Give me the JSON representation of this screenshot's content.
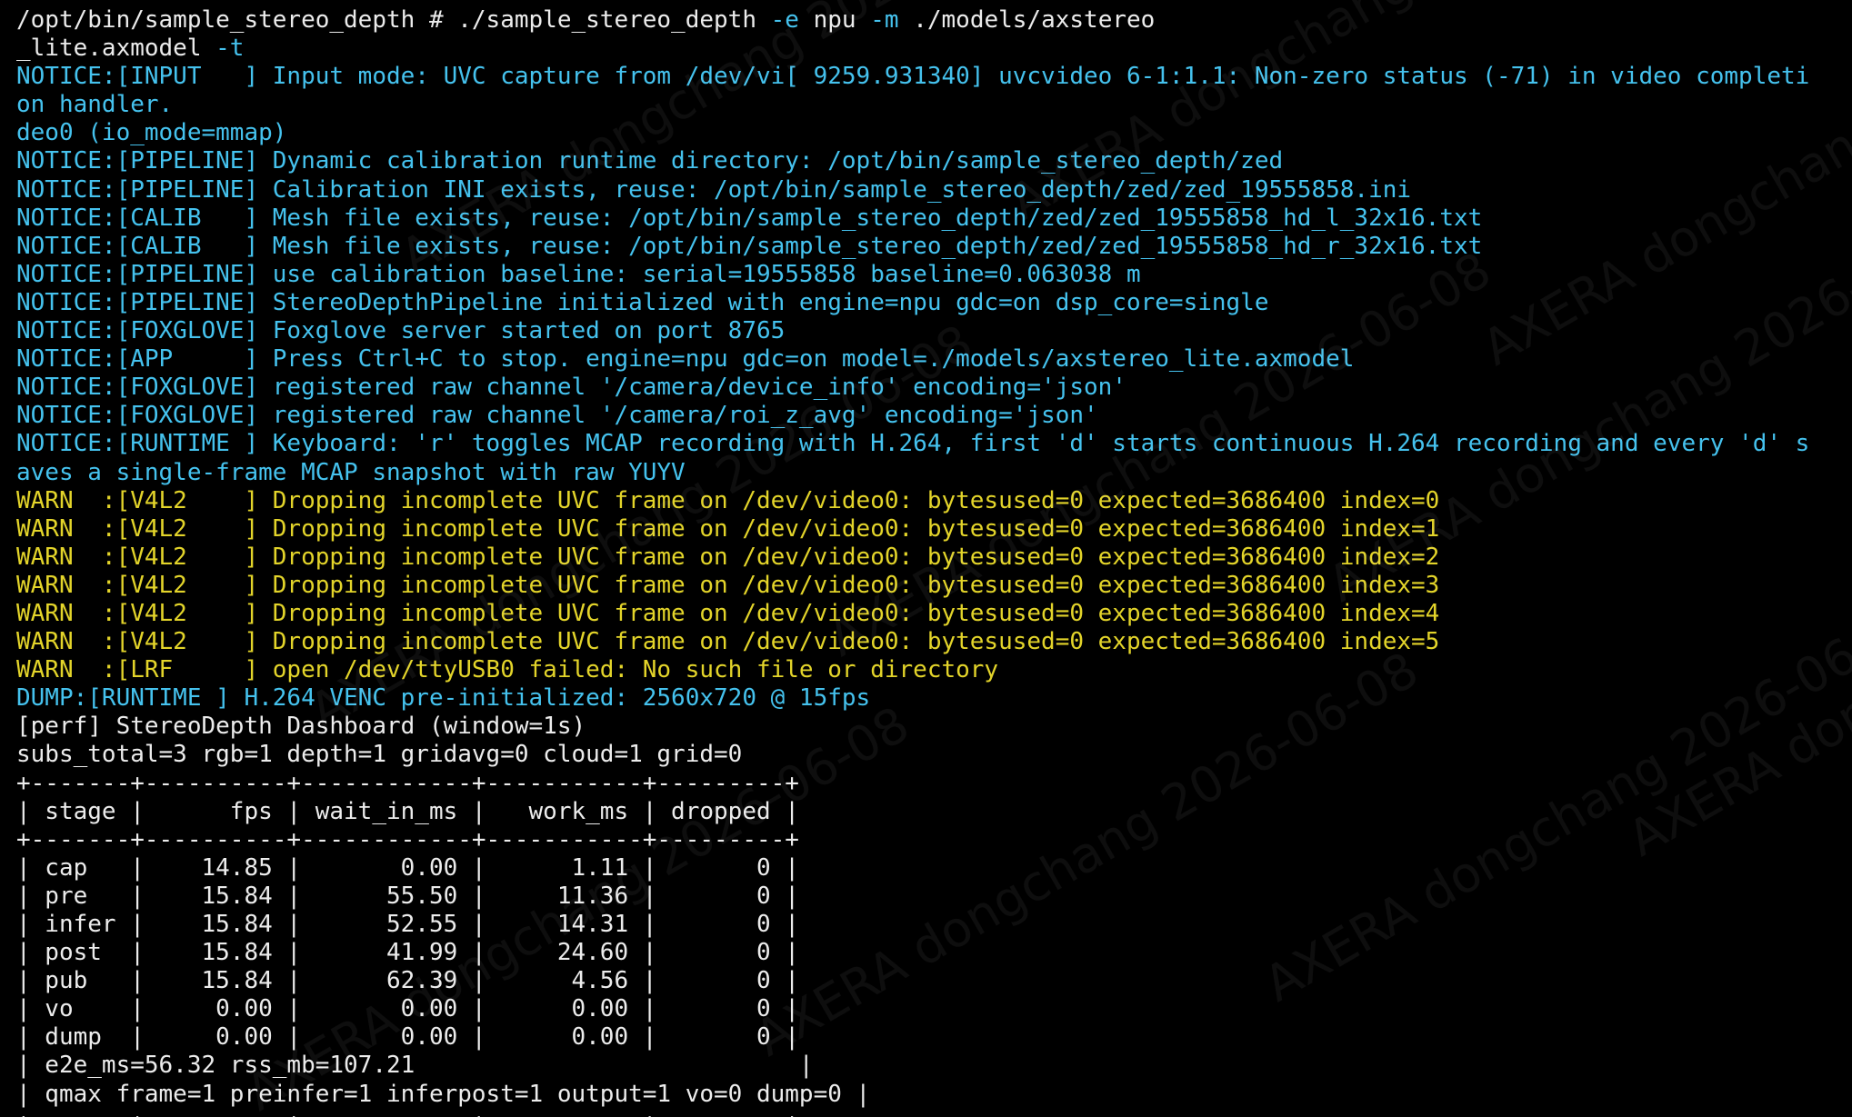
{
  "terminal": {
    "lines": [
      {
        "segments": [
          {
            "text": "/opt/bin/sample_stereo_depth # ./sample_stereo_depth ",
            "color": "w"
          },
          {
            "text": "-e",
            "color": "opt"
          },
          {
            "text": " npu ",
            "color": "w"
          },
          {
            "text": "-m",
            "color": "opt"
          },
          {
            "text": " ./models/axstereo",
            "color": "w"
          }
        ]
      },
      {
        "segments": [
          {
            "text": "_lite.axmodel ",
            "color": "w"
          },
          {
            "text": "-t",
            "color": "opt"
          }
        ]
      },
      {
        "segments": [
          {
            "text": "NOTICE:[INPUT   ] Input mode: UVC capture from /dev/vi[ 9259.931340] uvcvideo 6-1:1.1: Non-zero status (-71) in video completi",
            "color": "c"
          }
        ]
      },
      {
        "segments": [
          {
            "text": "on handler.",
            "color": "c"
          }
        ]
      },
      {
        "segments": [
          {
            "text": "deo0 (io_mode=mmap)",
            "color": "c"
          }
        ]
      },
      {
        "segments": [
          {
            "text": "NOTICE:[PIPELINE] Dynamic calibration runtime directory: /opt/bin/sample_stereo_depth/zed",
            "color": "c"
          }
        ]
      },
      {
        "segments": [
          {
            "text": "NOTICE:[PIPELINE] Calibration INI exists, reuse: /opt/bin/sample_stereo_depth/zed/zed_19555858.ini",
            "color": "c"
          }
        ]
      },
      {
        "segments": [
          {
            "text": "NOTICE:[CALIB   ] Mesh file exists, reuse: /opt/bin/sample_stereo_depth/zed/zed_19555858_hd_l_32x16.txt",
            "color": "c"
          }
        ]
      },
      {
        "segments": [
          {
            "text": "NOTICE:[CALIB   ] Mesh file exists, reuse: /opt/bin/sample_stereo_depth/zed/zed_19555858_hd_r_32x16.txt",
            "color": "c"
          }
        ]
      },
      {
        "segments": [
          {
            "text": "NOTICE:[PIPELINE] use calibration baseline: serial=19555858 baseline=0.063038 m",
            "color": "c"
          }
        ]
      },
      {
        "segments": [
          {
            "text": "NOTICE:[PIPELINE] StereoDepthPipeline initialized with engine=npu gdc=on dsp_core=single",
            "color": "c"
          }
        ]
      },
      {
        "segments": [
          {
            "text": "NOTICE:[FOXGLOVE] Foxglove server started on port 8765",
            "color": "c"
          }
        ]
      },
      {
        "segments": [
          {
            "text": "NOTICE:[APP     ] Press Ctrl+C to stop. engine=npu gdc=on model=./models/axstereo_lite.axmodel",
            "color": "c"
          }
        ]
      },
      {
        "segments": [
          {
            "text": "NOTICE:[FOXGLOVE] registered raw channel '/camera/device_info' encoding='json'",
            "color": "c"
          }
        ]
      },
      {
        "segments": [
          {
            "text": "NOTICE:[FOXGLOVE] registered raw channel '/camera/roi_z_avg' encoding='json'",
            "color": "c"
          }
        ]
      },
      {
        "segments": [
          {
            "text": "NOTICE:[RUNTIME ] Keyboard: 'r' toggles MCAP recording with H.264, first 'd' starts continuous H.264 recording and every 'd' s",
            "color": "c"
          }
        ]
      },
      {
        "segments": [
          {
            "text": "aves a single-frame MCAP snapshot with raw YUYV",
            "color": "c"
          }
        ]
      },
      {
        "segments": [
          {
            "text": "WARN  :[V4L2    ] Dropping incomplete UVC frame on /dev/video0: bytesused=0 expected=3686400 index=0",
            "color": "y"
          }
        ]
      },
      {
        "segments": [
          {
            "text": "WARN  :[V4L2    ] Dropping incomplete UVC frame on /dev/video0: bytesused=0 expected=3686400 index=1",
            "color": "y"
          }
        ]
      },
      {
        "segments": [
          {
            "text": "WARN  :[V4L2    ] Dropping incomplete UVC frame on /dev/video0: bytesused=0 expected=3686400 index=2",
            "color": "y"
          }
        ]
      },
      {
        "segments": [
          {
            "text": "WARN  :[V4L2    ] Dropping incomplete UVC frame on /dev/video0: bytesused=0 expected=3686400 index=3",
            "color": "y"
          }
        ]
      },
      {
        "segments": [
          {
            "text": "WARN  :[V4L2    ] Dropping incomplete UVC frame on /dev/video0: bytesused=0 expected=3686400 index=4",
            "color": "y"
          }
        ]
      },
      {
        "segments": [
          {
            "text": "WARN  :[V4L2    ] Dropping incomplete UVC frame on /dev/video0: bytesused=0 expected=3686400 index=5",
            "color": "y"
          }
        ]
      },
      {
        "segments": [
          {
            "text": "WARN  :[LRF     ] open /dev/ttyUSB0 failed: No such file or directory",
            "color": "y"
          }
        ]
      },
      {
        "segments": [
          {
            "text": "DUMP:[RUNTIME ] H.264 VENC pre-initialized: 2560x720 @ 15fps",
            "color": "c"
          }
        ]
      },
      {
        "segments": [
          {
            "text": "[perf] StereoDepth Dashboard (window=1s)",
            "color": "w"
          }
        ]
      },
      {
        "segments": [
          {
            "text": "subs_total=3 rgb=1 depth=1 gridavg=0 cloud=1 grid=0",
            "color": "w"
          }
        ]
      },
      {
        "segments": [
          {
            "text": "+-------+----------+------------+-----------+---------+",
            "color": "w"
          }
        ]
      },
      {
        "segments": [
          {
            "text": "| stage |      fps | wait_in_ms |   work_ms | dropped |",
            "color": "w"
          }
        ]
      },
      {
        "segments": [
          {
            "text": "+-------+----------+------------+-----------+---------+",
            "color": "w"
          }
        ]
      },
      {
        "segments": [
          {
            "text": "| cap   |    14.85 |       0.00 |      1.11 |       0 |",
            "color": "w"
          }
        ]
      },
      {
        "segments": [
          {
            "text": "| pre   |    15.84 |      55.50 |     11.36 |       0 |",
            "color": "w"
          }
        ]
      },
      {
        "segments": [
          {
            "text": "| infer |    15.84 |      52.55 |     14.31 |       0 |",
            "color": "w"
          }
        ]
      },
      {
        "segments": [
          {
            "text": "| post  |    15.84 |      41.99 |     24.60 |       0 |",
            "color": "w"
          }
        ]
      },
      {
        "segments": [
          {
            "text": "| pub   |    15.84 |      62.39 |      4.56 |       0 |",
            "color": "w"
          }
        ]
      },
      {
        "segments": [
          {
            "text": "| vo    |     0.00 |       0.00 |      0.00 |       0 |",
            "color": "w"
          }
        ]
      },
      {
        "segments": [
          {
            "text": "| dump  |     0.00 |       0.00 |      0.00 |       0 |",
            "color": "w"
          }
        ]
      },
      {
        "segments": [
          {
            "text": "| e2e_ms=56.32 rss_mb=107.21                           |",
            "color": "w"
          }
        ]
      },
      {
        "segments": [
          {
            "text": "| qmax frame=1 preinfer=1 inferpost=1 output=1 vo=0 dump=0 |",
            "color": "w"
          }
        ]
      },
      {
        "segments": [
          {
            "text": "+-------+----------+------------+-----------+---------+",
            "color": "w"
          }
        ]
      }
    ],
    "colors": {
      "background": "#000000",
      "default_text": "#ececec",
      "notice": "#45c2ee",
      "warn": "#e3d42a"
    }
  },
  "watermark": {
    "text": "AXERA dongchang 2026-06-08"
  }
}
